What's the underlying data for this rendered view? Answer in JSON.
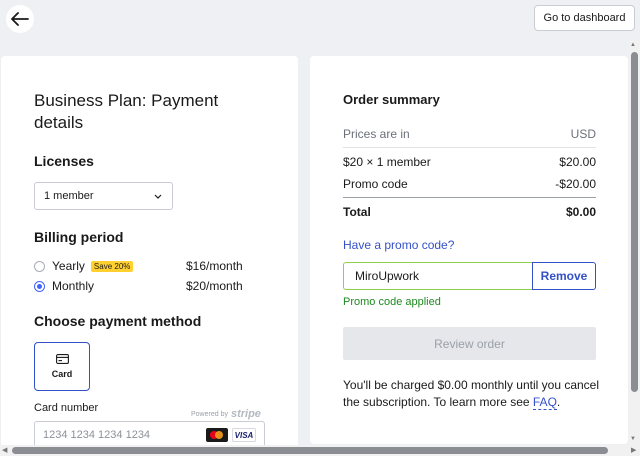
{
  "header": {
    "back_icon": "arrow-left-icon",
    "dashboard_label": "Go to dashboard"
  },
  "left": {
    "title": "Business Plan: Payment details",
    "licenses_heading": "Licenses",
    "licenses_value": "1 member",
    "billing_heading": "Billing period",
    "billing_options": [
      {
        "label": "Yearly",
        "badge": "Save 20%",
        "price": "$16/month",
        "selected": false
      },
      {
        "label": "Monthly",
        "price": "$20/month",
        "selected": true
      }
    ],
    "payment_heading": "Choose payment method",
    "card_tile_label": "Card",
    "card_number_label": "Card number",
    "powered_by": "Powered by",
    "powered_brand": "stripe",
    "card_number_placeholder": "1234 1234 1234 1234",
    "visa_label": "VISA"
  },
  "summary": {
    "title": "Order summary",
    "prices_in_label": "Prices are in",
    "currency": "USD",
    "line_item_label": "$20 × 1 member",
    "line_item_amount": "$20.00",
    "promo_label": "Promo code",
    "promo_amount": "-$20.00",
    "total_label": "Total",
    "total_amount": "$0.00",
    "promo_link": "Have a promo code?",
    "promo_value": "MiroUpwork",
    "remove_label": "Remove",
    "applied_text": "Promo code applied",
    "review_label": "Review order",
    "charge_text": "You'll be charged $0.00 monthly until you cancel the subscription. To learn more see",
    "faq_label": "FAQ"
  },
  "colors": {
    "accent": "#4262ff",
    "link": "#3451c7",
    "success": "#1d8a1f",
    "badge": "#ffd02f"
  }
}
